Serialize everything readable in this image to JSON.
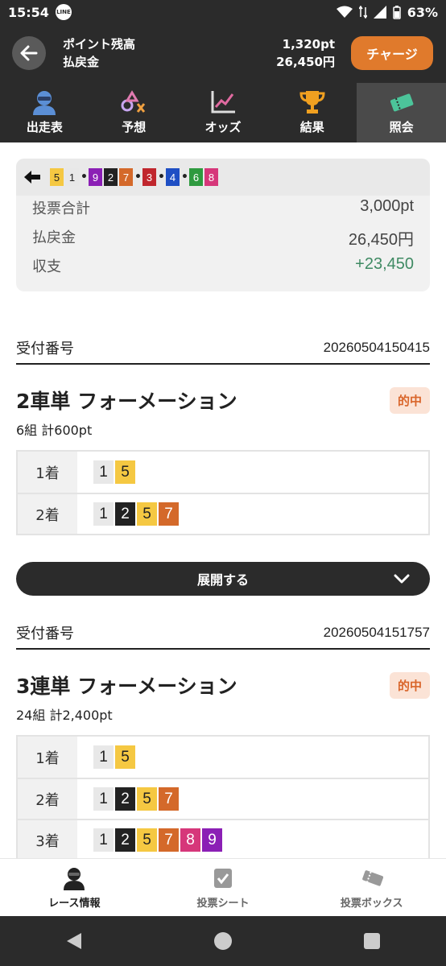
{
  "status": {
    "time": "15:54",
    "app_badge": "LINE",
    "battery": "63%"
  },
  "header": {
    "points_label": "ポイント残高",
    "payout_label": "払戻金",
    "points_value": "1,320pt",
    "payout_value": "26,450円",
    "charge_label": "チャージ"
  },
  "tabs": [
    {
      "label": "出走表",
      "icon": "racer-icon"
    },
    {
      "label": "予想",
      "icon": "prediction-icon"
    },
    {
      "label": "オッズ",
      "icon": "odds-chart-icon"
    },
    {
      "label": "結果",
      "icon": "trophy-icon"
    },
    {
      "label": "照会",
      "icon": "ticket-icon",
      "active": true
    }
  ],
  "race_strip": {
    "chips": [
      {
        "n": "5",
        "bg": "#f5c842",
        "fg": "#222"
      },
      {
        "n": "1",
        "bg": "#e8e8e8",
        "fg": "#222"
      },
      {
        "sep": "•"
      },
      {
        "n": "9",
        "bg": "#8b1fb5",
        "fg": "#fff"
      },
      {
        "n": "2",
        "bg": "#222222",
        "fg": "#fff"
      },
      {
        "n": "7",
        "bg": "#d4692a",
        "fg": "#fff"
      },
      {
        "sep": "•"
      },
      {
        "n": "3",
        "bg": "#c0262d",
        "fg": "#fff"
      },
      {
        "sep": "•"
      },
      {
        "n": "4",
        "bg": "#1f4fc4",
        "fg": "#fff"
      },
      {
        "sep": "•"
      },
      {
        "n": "6",
        "bg": "#2e9a3f",
        "fg": "#fff"
      },
      {
        "n": "8",
        "bg": "#d6377a",
        "fg": "#fff"
      }
    ]
  },
  "summary": {
    "total_label": "投票合計",
    "total_value": "3,000pt",
    "payout_label": "払戻金",
    "payout_value": "26,450円",
    "balance_label": "収支",
    "balance_value": "+23,450"
  },
  "receipts": [
    {
      "label": "受付番号",
      "number": "20260504150415",
      "title": "2車単 フォーメーション",
      "badge": "的中",
      "sub": "6組 計600pt",
      "rows": [
        {
          "pos": "1着",
          "nums": [
            "1",
            "5"
          ]
        },
        {
          "pos": "2着",
          "nums": [
            "1",
            "2",
            "5",
            "7"
          ]
        }
      ]
    },
    {
      "label": "受付番号",
      "number": "20260504151757",
      "title": "3連単 フォーメーション",
      "badge": "的中",
      "sub": "24組 計2,400pt",
      "rows": [
        {
          "pos": "1着",
          "nums": [
            "1",
            "5"
          ]
        },
        {
          "pos": "2着",
          "nums": [
            "1",
            "2",
            "5",
            "7"
          ]
        },
        {
          "pos": "3着",
          "nums": [
            "1",
            "2",
            "5",
            "7",
            "8",
            "9"
          ]
        }
      ]
    }
  ],
  "expand_label": "展開する",
  "num_colors": {
    "1": {
      "bg": "#e8e8e8",
      "fg": "#222"
    },
    "2": {
      "bg": "#222222",
      "fg": "#fff"
    },
    "3": {
      "bg": "#c0262d",
      "fg": "#fff"
    },
    "4": {
      "bg": "#1f4fc4",
      "fg": "#fff"
    },
    "5": {
      "bg": "#f5c842",
      "fg": "#222"
    },
    "6": {
      "bg": "#2e9a3f",
      "fg": "#fff"
    },
    "7": {
      "bg": "#d4692a",
      "fg": "#fff"
    },
    "8": {
      "bg": "#d6377a",
      "fg": "#fff"
    },
    "9": {
      "bg": "#8b1fb5",
      "fg": "#fff"
    }
  },
  "bottom_nav": [
    {
      "label": "レース情報",
      "icon": "racer-icon",
      "active": true
    },
    {
      "label": "投票シート",
      "icon": "checkbox-icon"
    },
    {
      "label": "投票ボックス",
      "icon": "tickets-icon"
    }
  ]
}
